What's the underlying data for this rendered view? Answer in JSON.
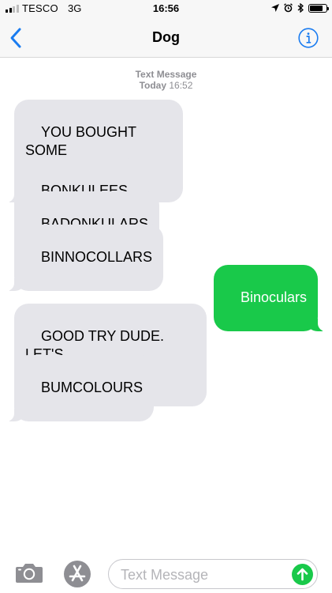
{
  "status_bar": {
    "carrier": "TESCO",
    "network": "3G",
    "time": "16:56",
    "signal_bars": 4,
    "signal_bars_filled": 2
  },
  "header": {
    "title": "Dog",
    "back_icon": "chevron-left-icon",
    "info_icon": "info-icon"
  },
  "thread": {
    "timestamp_label": "Text Message",
    "timestamp_day": "Today",
    "timestamp_time": "16:52",
    "messages": [
      {
        "direction": "incoming",
        "text": "YOU BOUGHT SOME\nBONNOCLES"
      },
      {
        "direction": "incoming",
        "text": "BONKULEES"
      },
      {
        "direction": "incoming",
        "text": "BADONKULARS"
      },
      {
        "direction": "incoming",
        "text": "BINNOCOLLARS"
      },
      {
        "direction": "outgoing",
        "text": "Binoculars"
      },
      {
        "direction": "incoming",
        "text": "GOOD TRY DUDE. LET'S\nKEEP GUESSING"
      },
      {
        "direction": "incoming",
        "text": "BUMCOLOURS"
      }
    ]
  },
  "composer": {
    "placeholder": "Text Message",
    "value": "",
    "camera_icon": "camera-icon",
    "apps_icon": "app-store-icon",
    "send_icon": "send-arrow-up-icon"
  },
  "colors": {
    "accent": "#1a7cf0",
    "outgoing_bubble": "#19c94a",
    "incoming_bubble": "#e5e5ea",
    "send_button": "#19c94a"
  }
}
